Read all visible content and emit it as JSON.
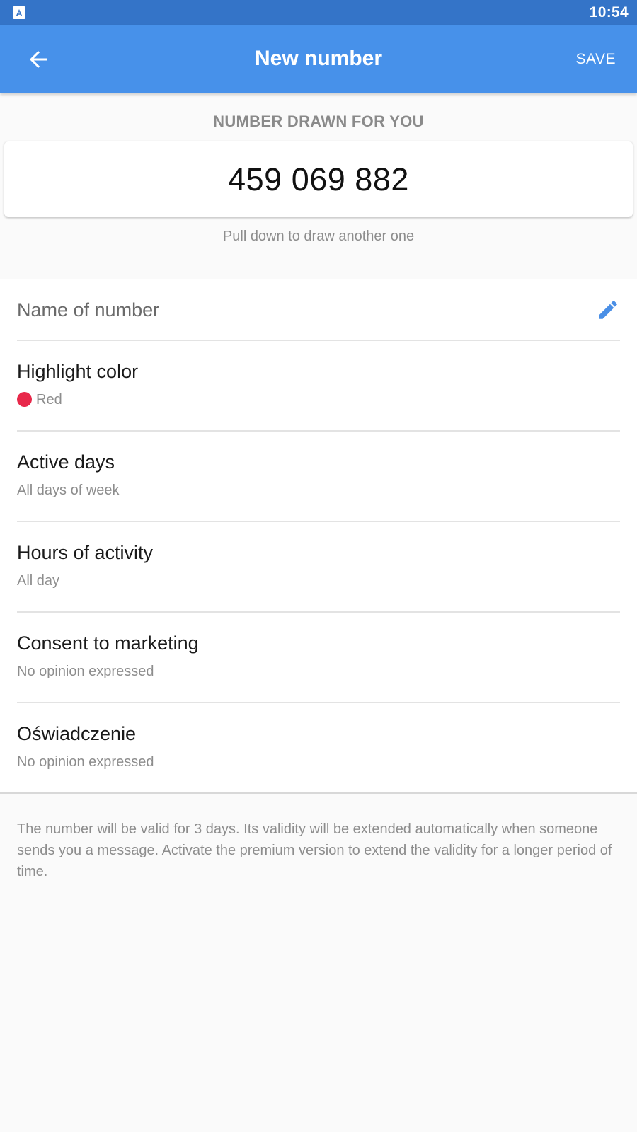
{
  "status_bar": {
    "time": "10:54",
    "app_icon": "app-notification-icon"
  },
  "app_bar": {
    "title": "New number",
    "back_icon": "arrow-back-icon",
    "save_label": "SAVE"
  },
  "number_section": {
    "heading": "NUMBER DRAWN FOR YOU",
    "number": "459 069 882",
    "hint": "Pull down to draw another one"
  },
  "name_field": {
    "placeholder": "Name of number",
    "edit_icon": "pencil-icon"
  },
  "settings": [
    {
      "title": "Highlight color",
      "value": "Red",
      "color": "#e8284a"
    },
    {
      "title": "Active days",
      "value": "All days of week"
    },
    {
      "title": "Hours of activity",
      "value": "All day"
    },
    {
      "title": "Consent to marketing",
      "value": "No opinion expressed"
    },
    {
      "title": "Oświadczenie",
      "value": "No opinion expressed"
    }
  ],
  "footer": {
    "note": "The number will be valid for 3 days. Its validity will be extended automatically when someone sends you a message. Activate the premium version to extend the validity for a longer period of time."
  },
  "colors": {
    "status_bar": "#3474c8",
    "app_bar": "#4791ea",
    "accent": "#4a8fe6"
  }
}
